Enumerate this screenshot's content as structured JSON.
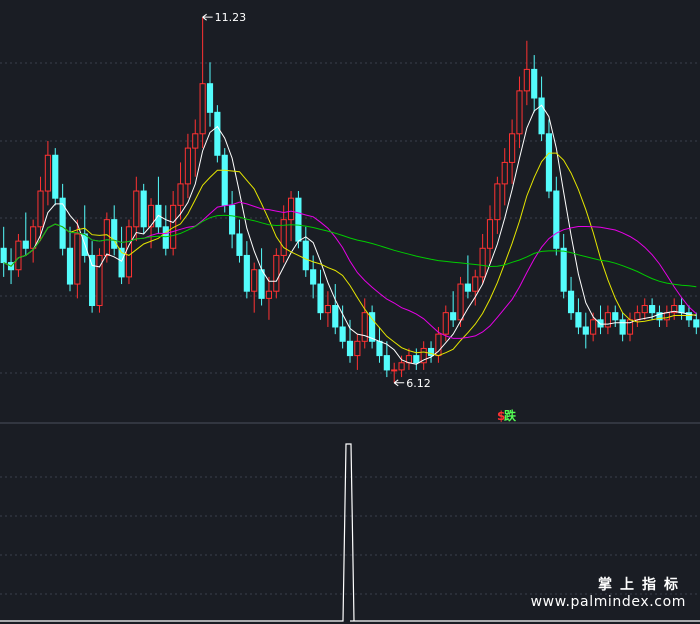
{
  "chart_data": [
    {
      "type": "candlestick",
      "title": "",
      "xlabel": "",
      "ylabel": "",
      "ylim": [
        5.6,
        11.4
      ],
      "grid": true,
      "legend": "none",
      "annotations": {
        "high_label": "11.23",
        "low_label": "6.12",
        "signal_icon": "$",
        "signal_label": "跌"
      },
      "candles": [
        {
          "o": 8.0,
          "h": 8.3,
          "l": 7.6,
          "c": 7.8
        },
        {
          "o": 7.8,
          "h": 8.0,
          "l": 7.5,
          "c": 7.7
        },
        {
          "o": 7.7,
          "h": 8.2,
          "l": 7.6,
          "c": 8.1
        },
        {
          "o": 8.1,
          "h": 8.5,
          "l": 7.9,
          "c": 8.0
        },
        {
          "o": 8.0,
          "h": 8.4,
          "l": 7.8,
          "c": 8.3
        },
        {
          "o": 8.3,
          "h": 9.0,
          "l": 8.1,
          "c": 8.8
        },
        {
          "o": 8.8,
          "h": 9.5,
          "l": 8.6,
          "c": 9.3
        },
        {
          "o": 9.3,
          "h": 9.4,
          "l": 8.6,
          "c": 8.7
        },
        {
          "o": 8.7,
          "h": 8.9,
          "l": 7.9,
          "c": 8.0
        },
        {
          "o": 8.0,
          "h": 8.3,
          "l": 7.4,
          "c": 7.5
        },
        {
          "o": 7.5,
          "h": 8.4,
          "l": 7.3,
          "c": 8.2
        },
        {
          "o": 8.2,
          "h": 8.6,
          "l": 7.8,
          "c": 7.9
        },
        {
          "o": 7.9,
          "h": 8.1,
          "l": 7.1,
          "c": 7.2
        },
        {
          "o": 7.2,
          "h": 8.0,
          "l": 7.1,
          "c": 7.9
        },
        {
          "o": 7.9,
          "h": 8.5,
          "l": 7.8,
          "c": 8.4
        },
        {
          "o": 8.4,
          "h": 8.6,
          "l": 7.9,
          "c": 8.0
        },
        {
          "o": 8.0,
          "h": 8.3,
          "l": 7.5,
          "c": 7.6
        },
        {
          "o": 7.6,
          "h": 8.4,
          "l": 7.5,
          "c": 8.3
        },
        {
          "o": 8.3,
          "h": 9.0,
          "l": 8.1,
          "c": 8.8
        },
        {
          "o": 8.8,
          "h": 8.9,
          "l": 8.2,
          "c": 8.3
        },
        {
          "o": 8.3,
          "h": 8.7,
          "l": 8.0,
          "c": 8.6
        },
        {
          "o": 8.6,
          "h": 9.0,
          "l": 8.2,
          "c": 8.3
        },
        {
          "o": 8.3,
          "h": 8.6,
          "l": 7.9,
          "c": 8.0
        },
        {
          "o": 8.0,
          "h": 8.8,
          "l": 7.9,
          "c": 8.6
        },
        {
          "o": 8.6,
          "h": 9.2,
          "l": 8.4,
          "c": 8.9
        },
        {
          "o": 8.9,
          "h": 9.6,
          "l": 8.7,
          "c": 9.4
        },
        {
          "o": 9.4,
          "h": 9.8,
          "l": 9.0,
          "c": 9.6
        },
        {
          "o": 9.6,
          "h": 11.23,
          "l": 9.4,
          "c": 10.3
        },
        {
          "o": 10.3,
          "h": 10.6,
          "l": 9.7,
          "c": 9.9
        },
        {
          "o": 9.9,
          "h": 10.0,
          "l": 9.2,
          "c": 9.3
        },
        {
          "o": 9.3,
          "h": 9.4,
          "l": 8.5,
          "c": 8.6
        },
        {
          "o": 8.6,
          "h": 8.8,
          "l": 8.0,
          "c": 8.2
        },
        {
          "o": 8.2,
          "h": 8.4,
          "l": 7.8,
          "c": 7.9
        },
        {
          "o": 7.9,
          "h": 8.1,
          "l": 7.3,
          "c": 7.4
        },
        {
          "o": 7.4,
          "h": 7.8,
          "l": 7.1,
          "c": 7.7
        },
        {
          "o": 7.7,
          "h": 8.0,
          "l": 7.2,
          "c": 7.3
        },
        {
          "o": 7.3,
          "h": 7.6,
          "l": 7.0,
          "c": 7.4
        },
        {
          "o": 7.4,
          "h": 8.0,
          "l": 7.3,
          "c": 7.9
        },
        {
          "o": 7.9,
          "h": 8.6,
          "l": 7.8,
          "c": 8.4
        },
        {
          "o": 8.4,
          "h": 8.8,
          "l": 8.1,
          "c": 8.7
        },
        {
          "o": 8.7,
          "h": 8.8,
          "l": 8.0,
          "c": 8.1
        },
        {
          "o": 8.1,
          "h": 8.3,
          "l": 7.6,
          "c": 7.7
        },
        {
          "o": 7.7,
          "h": 7.9,
          "l": 7.3,
          "c": 7.5
        },
        {
          "o": 7.5,
          "h": 7.7,
          "l": 7.0,
          "c": 7.1
        },
        {
          "o": 7.1,
          "h": 7.4,
          "l": 6.9,
          "c": 7.2
        },
        {
          "o": 7.2,
          "h": 7.5,
          "l": 6.8,
          "c": 6.9
        },
        {
          "o": 6.9,
          "h": 7.2,
          "l": 6.6,
          "c": 6.7
        },
        {
          "o": 6.7,
          "h": 7.0,
          "l": 6.4,
          "c": 6.5
        },
        {
          "o": 6.5,
          "h": 6.8,
          "l": 6.3,
          "c": 6.7
        },
        {
          "o": 6.7,
          "h": 7.3,
          "l": 6.6,
          "c": 7.1
        },
        {
          "o": 7.1,
          "h": 7.2,
          "l": 6.6,
          "c": 6.7
        },
        {
          "o": 6.7,
          "h": 6.9,
          "l": 6.4,
          "c": 6.5
        },
        {
          "o": 6.5,
          "h": 6.7,
          "l": 6.2,
          "c": 6.3
        },
        {
          "o": 6.3,
          "h": 6.4,
          "l": 6.12,
          "c": 6.3
        },
        {
          "o": 6.3,
          "h": 6.5,
          "l": 6.2,
          "c": 6.4
        },
        {
          "o": 6.4,
          "h": 6.6,
          "l": 6.3,
          "c": 6.5
        },
        {
          "o": 6.5,
          "h": 6.6,
          "l": 6.3,
          "c": 6.4
        },
        {
          "o": 6.4,
          "h": 6.7,
          "l": 6.3,
          "c": 6.6
        },
        {
          "o": 6.6,
          "h": 6.7,
          "l": 6.4,
          "c": 6.5
        },
        {
          "o": 6.5,
          "h": 6.9,
          "l": 6.4,
          "c": 6.8
        },
        {
          "o": 6.8,
          "h": 7.2,
          "l": 6.7,
          "c": 7.1
        },
        {
          "o": 7.1,
          "h": 7.4,
          "l": 6.9,
          "c": 7.0
        },
        {
          "o": 7.0,
          "h": 7.6,
          "l": 6.9,
          "c": 7.5
        },
        {
          "o": 7.5,
          "h": 7.9,
          "l": 7.3,
          "c": 7.4
        },
        {
          "o": 7.4,
          "h": 7.7,
          "l": 7.2,
          "c": 7.6
        },
        {
          "o": 7.6,
          "h": 8.2,
          "l": 7.5,
          "c": 8.0
        },
        {
          "o": 8.0,
          "h": 8.6,
          "l": 7.8,
          "c": 8.4
        },
        {
          "o": 8.4,
          "h": 9.0,
          "l": 8.2,
          "c": 8.9
        },
        {
          "o": 8.9,
          "h": 9.4,
          "l": 8.6,
          "c": 9.2
        },
        {
          "o": 9.2,
          "h": 9.8,
          "l": 8.9,
          "c": 9.6
        },
        {
          "o": 9.6,
          "h": 10.4,
          "l": 9.4,
          "c": 10.2
        },
        {
          "o": 10.2,
          "h": 10.9,
          "l": 10.0,
          "c": 10.5
        },
        {
          "o": 10.5,
          "h": 10.7,
          "l": 9.9,
          "c": 10.1
        },
        {
          "o": 10.1,
          "h": 10.4,
          "l": 9.5,
          "c": 9.6
        },
        {
          "o": 9.6,
          "h": 9.8,
          "l": 8.7,
          "c": 8.8
        },
        {
          "o": 8.8,
          "h": 9.0,
          "l": 7.9,
          "c": 8.0
        },
        {
          "o": 8.0,
          "h": 8.2,
          "l": 7.3,
          "c": 7.4
        },
        {
          "o": 7.4,
          "h": 7.6,
          "l": 7.0,
          "c": 7.1
        },
        {
          "o": 7.1,
          "h": 7.3,
          "l": 6.8,
          "c": 6.9
        },
        {
          "o": 6.9,
          "h": 7.1,
          "l": 6.6,
          "c": 6.8
        },
        {
          "o": 6.8,
          "h": 7.1,
          "l": 6.7,
          "c": 7.0
        },
        {
          "o": 7.0,
          "h": 7.2,
          "l": 6.8,
          "c": 6.9
        },
        {
          "o": 6.9,
          "h": 7.2,
          "l": 6.8,
          "c": 7.1
        },
        {
          "o": 7.1,
          "h": 7.2,
          "l": 6.9,
          "c": 7.0
        },
        {
          "o": 7.0,
          "h": 7.1,
          "l": 6.7,
          "c": 6.8
        },
        {
          "o": 6.8,
          "h": 7.1,
          "l": 6.7,
          "c": 7.0
        },
        {
          "o": 7.0,
          "h": 7.2,
          "l": 6.9,
          "c": 7.1
        },
        {
          "o": 7.1,
          "h": 7.3,
          "l": 7.0,
          "c": 7.2
        },
        {
          "o": 7.2,
          "h": 7.3,
          "l": 7.0,
          "c": 7.1
        },
        {
          "o": 7.1,
          "h": 7.2,
          "l": 6.9,
          "c": 7.0
        },
        {
          "o": 7.0,
          "h": 7.2,
          "l": 6.9,
          "c": 7.1
        },
        {
          "o": 7.1,
          "h": 7.3,
          "l": 7.0,
          "c": 7.2
        },
        {
          "o": 7.2,
          "h": 7.3,
          "l": 7.0,
          "c": 7.1
        },
        {
          "o": 7.1,
          "h": 7.2,
          "l": 6.9,
          "c": 7.0
        },
        {
          "o": 7.0,
          "h": 7.1,
          "l": 6.8,
          "c": 6.9
        }
      ],
      "moving_averages": [
        {
          "period": 5,
          "color": "#ffffff"
        },
        {
          "period": 10,
          "color": "#e5e600"
        },
        {
          "period": 20,
          "color": "#e600e6"
        },
        {
          "period": 60,
          "color": "#00cc00"
        }
      ],
      "colors": {
        "up": "#ff3232",
        "down": "#54fcfc",
        "grid": "#3a3f4b",
        "background": "#1a1d24"
      }
    },
    {
      "type": "line",
      "title": "",
      "ylim": [
        0,
        1
      ],
      "grid": true,
      "series": [
        {
          "color": "#ffffff",
          "values": [
            0,
            0,
            0,
            0,
            0,
            0,
            0,
            0,
            0,
            0,
            0,
            0,
            0,
            0,
            0,
            0,
            0,
            0,
            0,
            0,
            0,
            0,
            0,
            0,
            0,
            0,
            0,
            0,
            0,
            0,
            0,
            0,
            0,
            0,
            0,
            0,
            0,
            0,
            0,
            0,
            0,
            0,
            0,
            0,
            0,
            0,
            0,
            0,
            0,
            0,
            0,
            0,
            0,
            0,
            0,
            0,
            0,
            0,
            0,
            0,
            0,
            0,
            0,
            0,
            0,
            0,
            0,
            0,
            0,
            0,
            0,
            0,
            0,
            0,
            0,
            0,
            0,
            0,
            0,
            0,
            0,
            0,
            0,
            0,
            0,
            0,
            0,
            0,
            0,
            0,
            0,
            0,
            0,
            0,
            0,
            0,
            0,
            0,
            0,
            0
          ]
        }
      ],
      "spike_index": 49
    }
  ],
  "watermark": {
    "line1": "掌上指标",
    "line2": "www.palmindex.com"
  }
}
